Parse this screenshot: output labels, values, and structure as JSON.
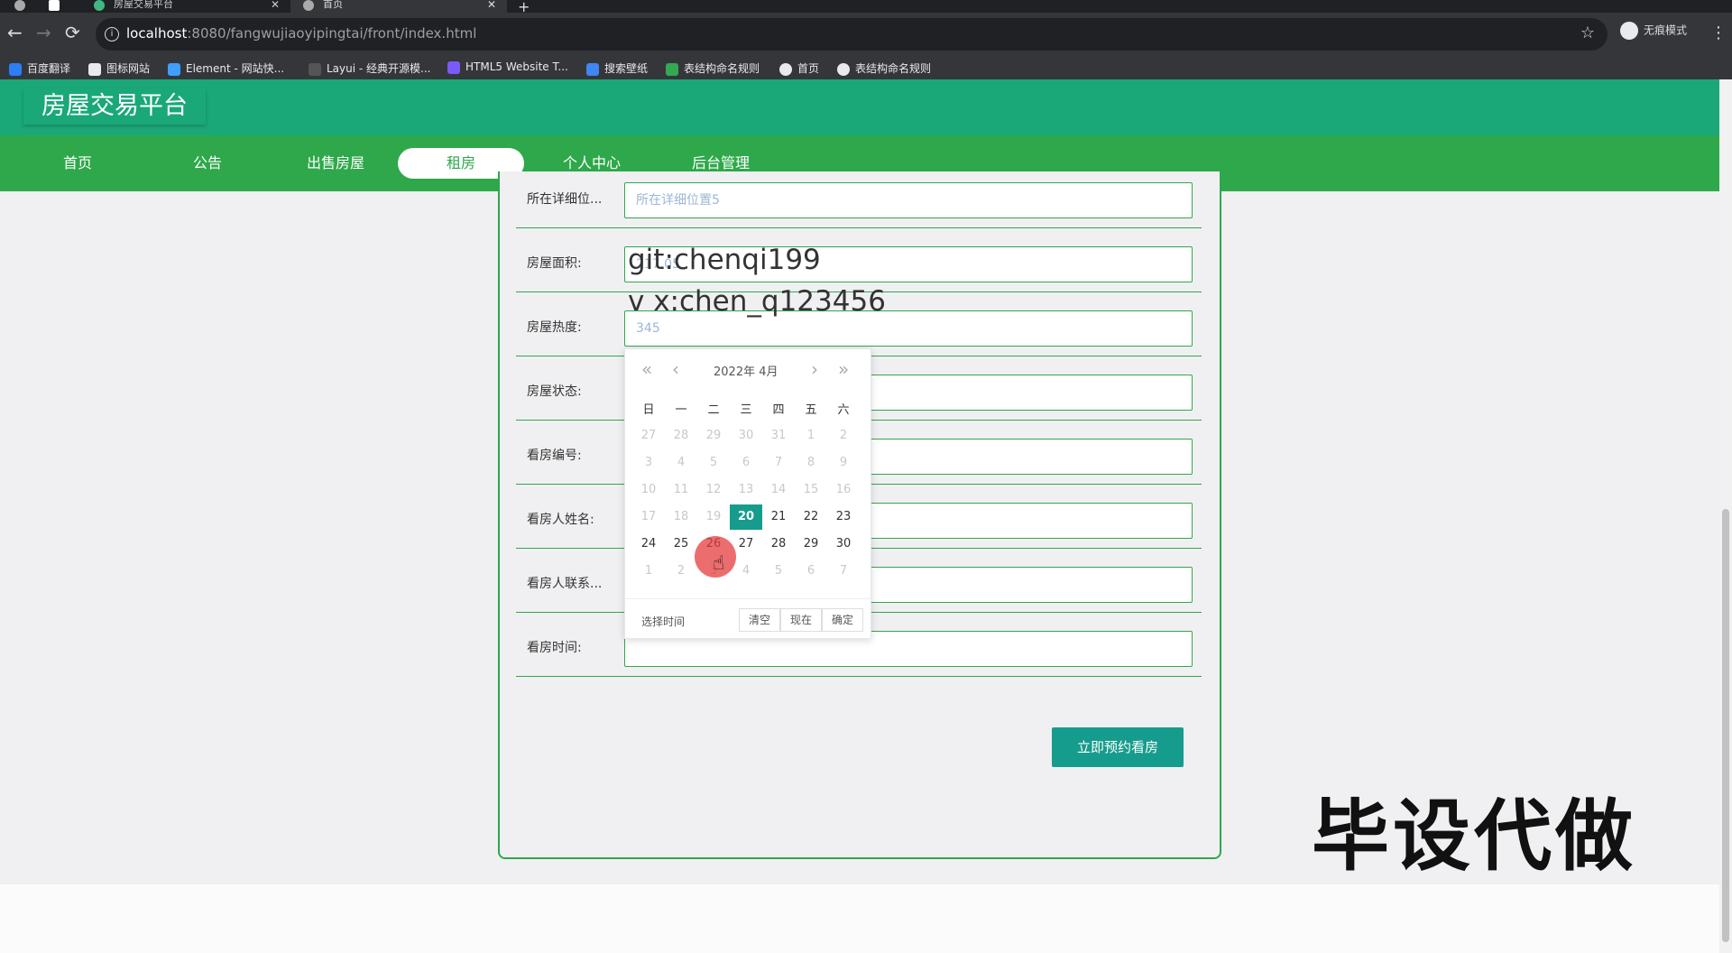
{
  "browser": {
    "tabs": [
      {
        "label": "房屋交易平台"
      },
      {
        "label": "首页"
      }
    ],
    "url_host": "localhost",
    "url_rest": ":8080/fangwujiaoyipingtai/front/index.html",
    "profile_label": "无痕模式",
    "bookmarks": [
      "百度翻译",
      "图标网站",
      "Element - 网站快...",
      "Layui - 经典开源模...",
      "HTML5 Website T...",
      "搜索壁纸",
      "表结构命名规则",
      "首页",
      "表结构命名规则"
    ]
  },
  "site": {
    "title": "房屋交易平台",
    "nav": [
      "首页",
      "公告",
      "出售房屋",
      "租房",
      "个人中心",
      "后台管理"
    ],
    "active_nav": "租房"
  },
  "form": {
    "rows": [
      {
        "label": "所在详细位...",
        "value": "所在详细位置5"
      },
      {
        "label": "房屋面积:",
        "value": "217.05"
      },
      {
        "label": "房屋热度:",
        "value": "345"
      },
      {
        "label": "房屋状态:",
        "value": ""
      },
      {
        "label": "看房编号:",
        "value": ""
      },
      {
        "label": "看房人姓名:",
        "value": ""
      },
      {
        "label": "看房人联系...",
        "value": ""
      },
      {
        "label": "看房时间:",
        "value": ""
      }
    ],
    "submit_label": "立即预约看房"
  },
  "datepicker": {
    "year_month": "2022年  4月",
    "weekdays": [
      "日",
      "一",
      "二",
      "三",
      "四",
      "五",
      "六"
    ],
    "weeks": [
      [
        "27",
        "28",
        "29",
        "30",
        "31",
        "1",
        "2"
      ],
      [
        "3",
        "4",
        "5",
        "6",
        "7",
        "8",
        "9"
      ],
      [
        "10",
        "11",
        "12",
        "13",
        "14",
        "15",
        "16"
      ],
      [
        "17",
        "18",
        "19",
        "20",
        "21",
        "22",
        "23"
      ],
      [
        "24",
        "25",
        "26",
        "27",
        "28",
        "29",
        "30"
      ],
      [
        "1",
        "2",
        "3",
        "4",
        "5",
        "6",
        "7"
      ]
    ],
    "selected": "20",
    "select_time_label": "选择时间",
    "buttons": [
      "清空",
      "现在",
      "确定"
    ]
  },
  "overlay": {
    "watermark_line1": "git:chenqi199",
    "watermark_line2": "v x:chen_q123456",
    "big_text": "毕设代做"
  },
  "colors": {
    "header_green": "#1aa879",
    "nav_green": "#2ea84a",
    "button_teal": "#169c8c"
  }
}
